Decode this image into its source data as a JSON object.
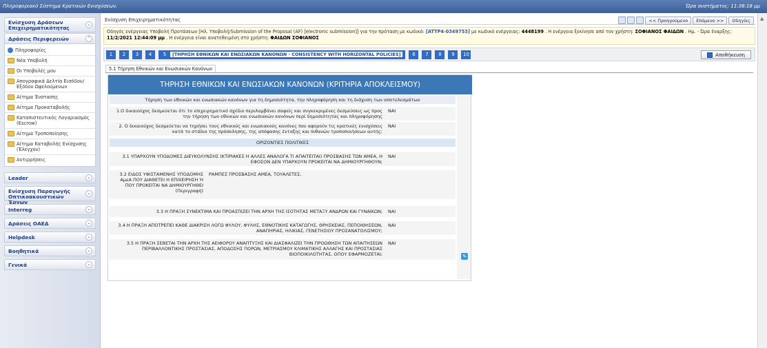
{
  "topbar": {
    "app_title": "Πληροφοριακό Σύστημα Κρατικών Ενισχύσεων.",
    "clock": "Ώρα συστήματος: 11:38:18 μμ"
  },
  "sidebar": {
    "sections": [
      {
        "label": "Ενίσχυση Δράσεων Επιχειρηματικότητας",
        "chevron": "⌄"
      },
      {
        "label": "Δράσεις Περιφερειών",
        "chevron": "⌃"
      }
    ],
    "items": [
      {
        "label": "Πληροφορίες",
        "icon": "info-icon"
      },
      {
        "label": "Νέα Υποβολή",
        "icon": "folder-icon"
      },
      {
        "label": "Οι Υποβολές μου",
        "icon": "folder-icon"
      },
      {
        "label": "Απογραφικά Δελτία Εισόδου/ Εξόδου Ωφελούμενων",
        "icon": "folder-icon"
      },
      {
        "label": "Αίτημα Ένστασης",
        "icon": "folder-icon"
      },
      {
        "label": "Αίτημα Προκαταβολής",
        "icon": "folder-icon"
      },
      {
        "label": "Καταπιστευτικός Λογαριασμός (Escrow)",
        "icon": "folder-icon"
      },
      {
        "label": "Αίτημα Τροποποίησης",
        "icon": "folder-icon"
      },
      {
        "label": "Αίτημα Καταβολής Ενίσχυσης (Έλεγχου)",
        "icon": "folder-icon"
      },
      {
        "label": "Αντιρρήσεις",
        "icon": "folder-icon"
      }
    ],
    "bottom_sections": [
      {
        "label": "Leader"
      },
      {
        "label": "Ενίσχυση Παραγωγής Οπτικοακουστικών Έργων"
      },
      {
        "label": "Interreg"
      },
      {
        "label": "Δράσεις ΟΑΕΔ"
      },
      {
        "label": "Helpdesk"
      },
      {
        "label": "Βοηθητικά"
      },
      {
        "label": "Γενικά"
      }
    ]
  },
  "header": {
    "breadcrumb": "Ενίσχυση Επιχειρηματικότητας",
    "prev": "<< Προηγούμενο",
    "next": "Επόμενο >>",
    "help": "Οδηγίες"
  },
  "guide": {
    "part1": "Οδηγός ενέργειας Υποβολή Προτάσεων [Ηλ. Υποβολή/Submission of the Proposal (AF) [electronic submission]] για την πρόταση με κωδικό:",
    "code": "[ATTP4-0349753]",
    "part2": "με κωδικό ενέργειας:",
    "action_code": "4448199",
    "part3": ". Η ενέργεια ξεκίνησε από τον χρήστη:",
    "user_start": "ΣΟΦΙΑΝΟΣ ΦΑΙΔΩΝ",
    "part4": ". Ημ. - Ώρα έναρξης:",
    "datetime": "11/2/2021 12:44:09 μμ",
    "part5": ". Η ενέργεια είναι ανατεθειμένη στο χρήστη:",
    "user_assigned": "ΦΑΙΔΩΝ ΣΟΦΙΑΝΟΣ"
  },
  "steps": {
    "items": [
      "1",
      "2",
      "3",
      "4"
    ],
    "active_num": "5",
    "active_label": "[ΤΗΡΗΣΗ ΕΘΝΙΚΩΝ ΚΑΙ ΕΝΩΣΙΑΚΩΝ ΚΑΝΟΝΩΝ - CONSISTENCY WITH HORIZONTAL POLICIES]",
    "after": [
      "6",
      "7",
      "8",
      "9",
      "10"
    ],
    "save": "Αποθήκευση"
  },
  "subtab": "5.1 Τήρηση Εθνικών και Ενωσιακών Κανόνων",
  "panel": {
    "title": "ΤΗΡΗΣΗ ΕΘΝΙΚΩΝ ΚΑΙ ΕΝΩΣΙΑΚΩΝ ΚΑΝΟΝΩΝ (ΚΡΙΤΗΡΙΑ ΑΠΟΚΛΕΙΣΜΟΥ)",
    "intro": "Τήρηση των εθνικών και ενωσιακών κανόνων για τη δημοσιότητα, την πληροφόρηση και τη διάχυση των αποτελεσμάτων",
    "q1": "1.Ο δικαιούχος δεσμεύεται ότι το επιχειρηματικό σχέδιο περιλαμβάνει σαφείς και συγκεκριμένες δεσμεύσεις ως προς την τήρηση των εθνικών και ενωσιακών κανόνων περί δημοσιότητας και πληροφόρησης",
    "a1": "ΝΑΙ",
    "q2": "2. Ο δικαιούχος δεσμεύεται να τηρήσει τους εθνικούς και ενωσιακούς κανόνες που αφορούν τις κρατικές ενισχύσεις κατά το στάδιο της πρόσκλησης, της απόφασης ένταξης και πιθανών τροποποιήσεων αυτής;",
    "a2": "ΝΑΙ",
    "horizontal": "ΟΡΙΖΟΝΤΙΕΣ ΠΟΛΙΤΙΚΕΣ",
    "q31": "3.1 ΥΠΑΡΧΟΥΝ ΥΠΟΔΟΜΕΣ ΔΙΕΥΚΟΛΥΝΣΗΣ (ΚΤΙΡΙΑΚΕΣ Η ΑΛΛΕΣ ΑΝΑΛΟΓΑ ΤΙ ΑΠΑΙΤΕΙΤΑΙ) ΠΡΟΣΒΑΣΗΣ ΤΩΝ ΑΜΕΑ, Η ΕΦΟΣΟΝ ΔΕΝ ΥΠΑΡΧΟΥΝ ΠΡΟΚΕΙΤΑΙ ΝΑ ΔΗΜΙΟΥΡΓΗΘΟΥΝ;",
    "a31": "ΝΑΙ",
    "q32": "3.2 ΕΙΔΟΣ ΥΦΙΣΤΑΜΕΝΗΣ ΥΠΟΔΟΜΗΣ ΑμεΑ ΠΟΥ ΔΙΑΘΕΤΕΙ Η ΕΠΙΧΕΙΡΗΣΗ Ή ΠΟΥ ΠΡΟΚΕΙΤΑΙ ΝΑ ΔΗΜΙΟΥΡΓΗΘΕΙ (Περιγραφή)",
    "a32": "ΡΑΜΠΕΣ ΠΡΟΣΒΑΣΗΣ ΑΜΕΑ, ΤΟΥΑΛΕΤΕΣ,",
    "q33": "3.3 Η ΠΡΑΞΗ ΣΥΝΕΚΤΙΜΑ ΚΑΙ ΠΡΟΑΣΠΙΖΕΙ ΤΗΝ ΑΡΧΗ ΤΗΣ ΙΣΟΤΗΤΑΣ ΜΕΤΑΞΥ ΑΝΔΡΩΝ ΚΑΙ ΓΥΝΑΙΚΩΝ;",
    "a33": "ΝΑΙ",
    "q34": "3.4 Η ΠΡΑΞΗ ΑΠΟΤΡΕΠΕΙ ΚΑΘΕ ΔΙΑΚΡΙΣΗ ΛΟΓΩ ΦΥΛΟΥ, ΦΥΛΗΣ, ΕΘΝΟΤΙΚΗΣ ΚΑΤΑΓΩΓΗΣ, ΘΡΗΣΚΕΙΑΣ, ΠΕΠΟΙΘΗΣΕΩΝ, ΑΝΑΠΗΡΙΑΣ, ΗΛΙΚΙΑΣ, ΓΕΝΕΤΗΣΙΟΥ ΠΡΟΣΑΝΑΤΟΛΙΣΜΟΥ;",
    "a34": "ΝΑΙ",
    "q35": "3.5 Η ΠΡΑΞΗ ΣΕΒΕΤΑΙ ΤΗΝ ΑΡΧΗ ΤΗΣ ΑΕΙΦΟΡΟΥ ΑΝΑΠΤΥΞΗΣ ΚΑΙ ΔΙΑΣΦΑΛΙΖΕΙ ΤΗΝ ΠΡΟΩΘΗΣΗ ΤΩΝ ΑΠΑΙΤΗΣΕΩΝ ΠΕΡΙΒΑΛΛΟΝΤΙΚΗΣ ΠΡΟΣΤΑΣΙΑΣ, ΑΠΟΔΟΣΗΣ ΠΟΡΩΝ, ΜΕΤΡΙΑΣΜΟΥ ΚΛΙΜΑΤΙΚΗΣ ΑΛΛΑΓΗΣ ΚΑΙ ΠΡΟΣΤΑΣΙΑΣ ΒΙΟΠΟΙΚΙΛΟΤΗΤΑΣ, ΟΠΟΥ ΕΦΑΡΜΟΖΕΤΑΙ;",
    "a35": "ΝΑΙ"
  }
}
